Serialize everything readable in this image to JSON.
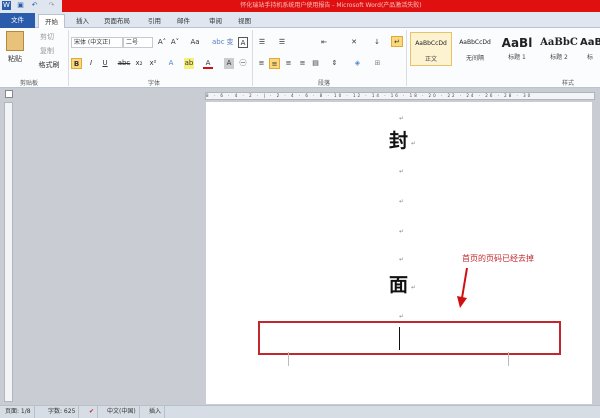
{
  "window": {
    "title": "怀化瑞站手持机系统用户使用报告 - Microsoft Word(产品激活失败)"
  },
  "tabs": [
    "文件",
    "开始",
    "插入",
    "页面布局",
    "引用",
    "邮件",
    "审阅",
    "视图"
  ],
  "clipboard": {
    "paste": "粘贴",
    "cut": "剪切",
    "copy": "复制",
    "format_painter": "格式刷",
    "group": "剪贴板"
  },
  "font": {
    "name": "宋体 (中文正)",
    "size": "二号",
    "group": "字体",
    "bold": "B",
    "italic": "I",
    "underline": "U",
    "strike": "abc",
    "sub": "x₂",
    "sup": "x²",
    "grow": "A˄",
    "shrink": "A˅",
    "case": "Aa"
  },
  "paragraph": {
    "group": "段落"
  },
  "styles": {
    "group": "样式",
    "items": [
      {
        "preview": "AaBbCcDd",
        "name": "正文"
      },
      {
        "preview": "AaBbCcDd",
        "name": "无间隔"
      },
      {
        "preview": "AaBl",
        "name": "标题 1"
      },
      {
        "preview": "AaBbC",
        "name": "标题 2"
      },
      {
        "preview": "AaB",
        "name": "标"
      }
    ]
  },
  "ruler": "8 · 6 · 4 · 2 · | · 2 · 4 · 6 · 8 · 10 · 12 · 14 · 16 · 18 · 20 · 22 · 24 · 26 · 28 · 30",
  "document": {
    "char1": "封",
    "char2": "面",
    "para_mark": "↵"
  },
  "annotation": {
    "text": "首页的页码已经去掉",
    "color": "#c0282e"
  },
  "status": {
    "page": "页面: 1/8",
    "words": "字数: 625",
    "language": "中文(中国)",
    "mode": "插入"
  }
}
